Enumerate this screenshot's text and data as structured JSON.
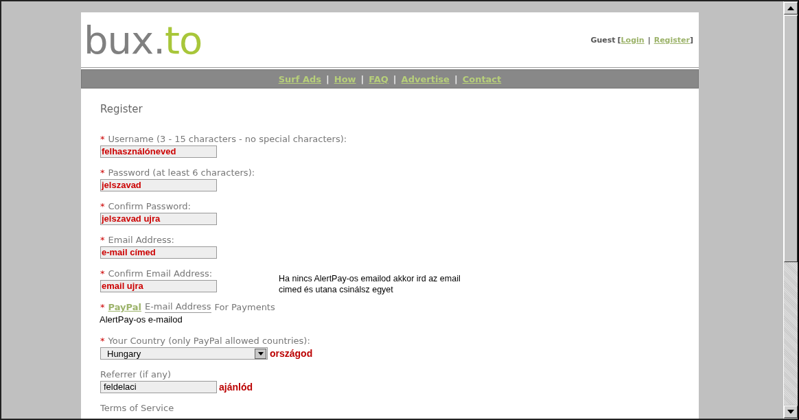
{
  "header": {
    "logo": {
      "first": "bux.",
      "second": "to"
    },
    "account": {
      "guest": "Guest",
      "open": "[",
      "separator": "|",
      "close": "]",
      "links": [
        "Login",
        "Register"
      ]
    }
  },
  "nav": {
    "links": [
      "Surf Ads",
      "How",
      "FAQ",
      "Advertise",
      "Contact"
    ],
    "separator": "|"
  },
  "form": {
    "title": "Register",
    "fields": [
      {
        "kind": "text",
        "marker": "*",
        "label": "Username (3 - 15 characters - no special characters):",
        "value": "felhasználóneved",
        "annotated": true
      },
      {
        "kind": "text",
        "marker": "*",
        "label": "Password (at least 6 characters):",
        "value": "jelszavad",
        "annotated": true
      },
      {
        "kind": "text",
        "marker": "*",
        "label": "Confirm Password:",
        "value": "jelszavad ujra",
        "annotated": true
      },
      {
        "kind": "text",
        "marker": "*",
        "label": "Email Address:",
        "value": "e-mail címed",
        "annotated": true
      },
      {
        "kind": "text",
        "marker": "*",
        "label": "Confirm Email Address:",
        "value": "email ujra",
        "annotated": true,
        "side_note": "Ha nincs AlertPay-os emailod akkor ird az email cimed és utana csinálsz egyet"
      },
      {
        "kind": "paypal",
        "marker": "*",
        "link": "PayPal",
        "label": "E-mail Address",
        "label_after": "For Payments",
        "note": "AlertPay-os e-mailod"
      },
      {
        "kind": "select",
        "marker": "*",
        "label": "Your Country (only PayPal allowed countries):",
        "value": "Hungary",
        "note": "országod"
      },
      {
        "kind": "text",
        "label": "Referrer (if any)",
        "value": "feldelaci",
        "annotated": false,
        "note": "ajánlód"
      },
      {
        "kind": "heading",
        "label": "Terms of Service"
      }
    ]
  }
}
